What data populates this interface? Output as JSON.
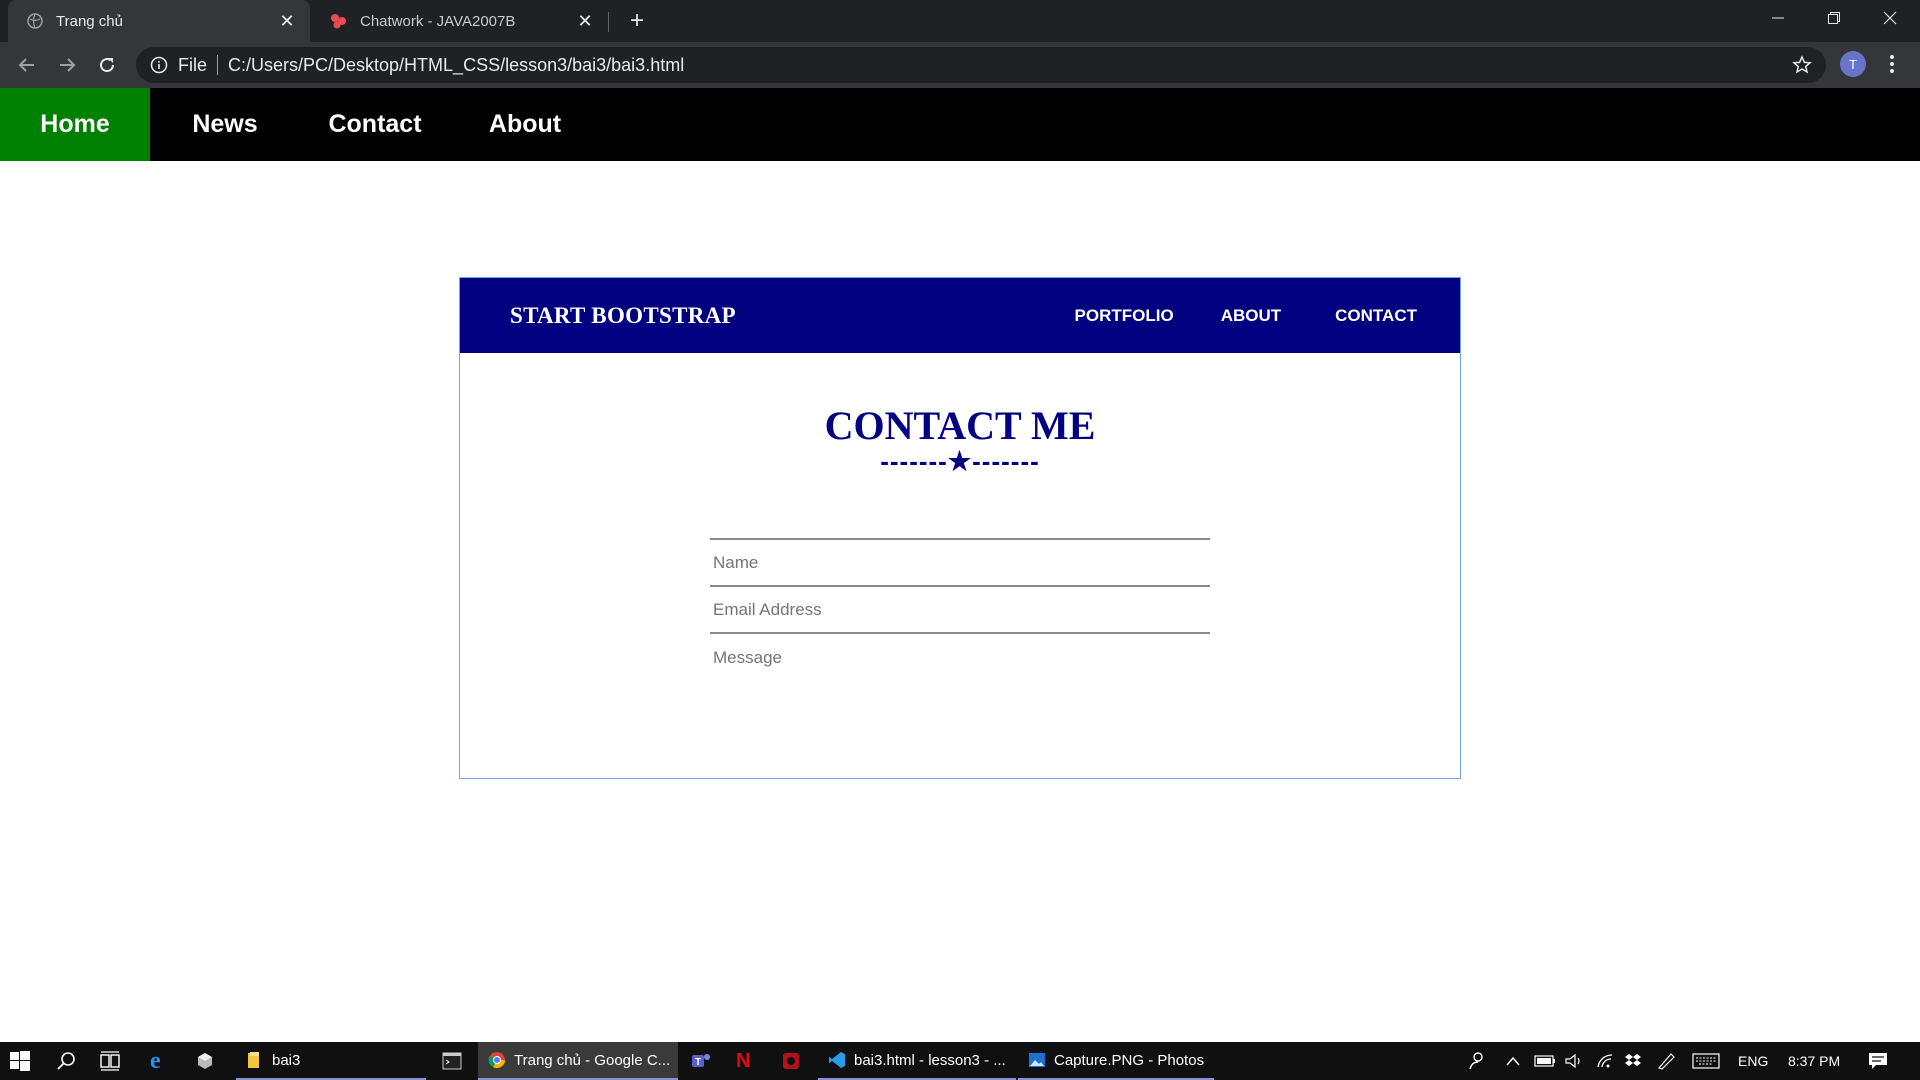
{
  "browser": {
    "tabs": [
      {
        "title": "Trang chủ",
        "active": true
      },
      {
        "title": "Chatwork - JAVA2007B",
        "active": false
      }
    ],
    "address": {
      "scheme_label": "File",
      "url": "C:/Users/PC/Desktop/HTML_CSS/lesson3/bai3/bai3.html"
    },
    "profile_initial": "T"
  },
  "page": {
    "topnav": {
      "items": [
        "Home",
        "News",
        "Contact",
        "About"
      ],
      "active_color": "#008000"
    },
    "card": {
      "brand": "START BOOTSTRAP",
      "nav": [
        "PORTFOLIO",
        "ABOUT",
        "CONTACT"
      ],
      "header_color": "#000080",
      "heading": "CONTACT ME",
      "divider": "-------★-------",
      "form": {
        "name_placeholder": "Name",
        "email_placeholder": "Email Address",
        "message_placeholder": "Message"
      }
    }
  },
  "taskbar": {
    "apps": [
      {
        "label": "bai3",
        "icon": "folder-icon"
      },
      {
        "label": "Trang chủ - Google C...",
        "icon": "chrome-icon"
      },
      {
        "label": "bai3.html - lesson3 - ...",
        "icon": "vscode-icon"
      },
      {
        "label": "Capture.PNG - Photos",
        "icon": "photos-icon"
      }
    ],
    "tray": {
      "language": "ENG",
      "time": "8:37 PM"
    }
  }
}
